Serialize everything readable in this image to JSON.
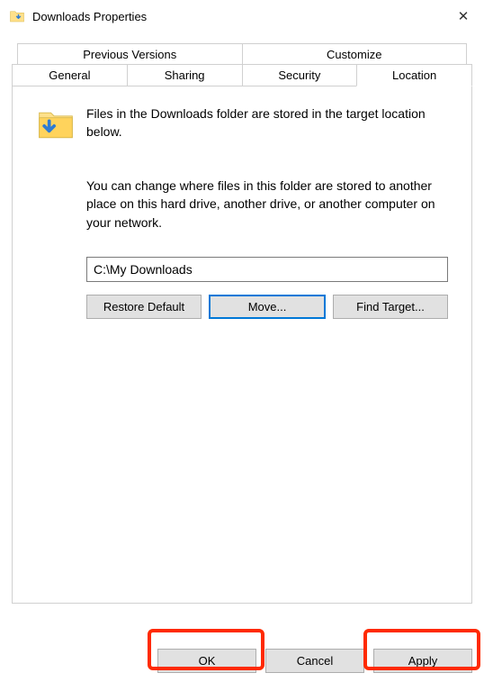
{
  "window": {
    "title": "Downloads Properties",
    "close_icon_glyph": "✕"
  },
  "tabs": {
    "row1": [
      {
        "label": "Previous Versions"
      },
      {
        "label": "Customize"
      }
    ],
    "row2": [
      {
        "label": "General"
      },
      {
        "label": "Sharing"
      },
      {
        "label": "Security"
      },
      {
        "label": "Location",
        "active": true
      }
    ]
  },
  "location": {
    "desc1": "Files in the Downloads folder are stored in the target location below.",
    "desc2": "You can change where files in this folder are stored to another place on this hard drive, another drive, or another computer on your network.",
    "path_value": "C:\\My Downloads",
    "buttons": {
      "restore": "Restore Default",
      "move": "Move...",
      "find": "Find Target..."
    }
  },
  "footer": {
    "ok": "OK",
    "cancel": "Cancel",
    "apply": "Apply"
  }
}
